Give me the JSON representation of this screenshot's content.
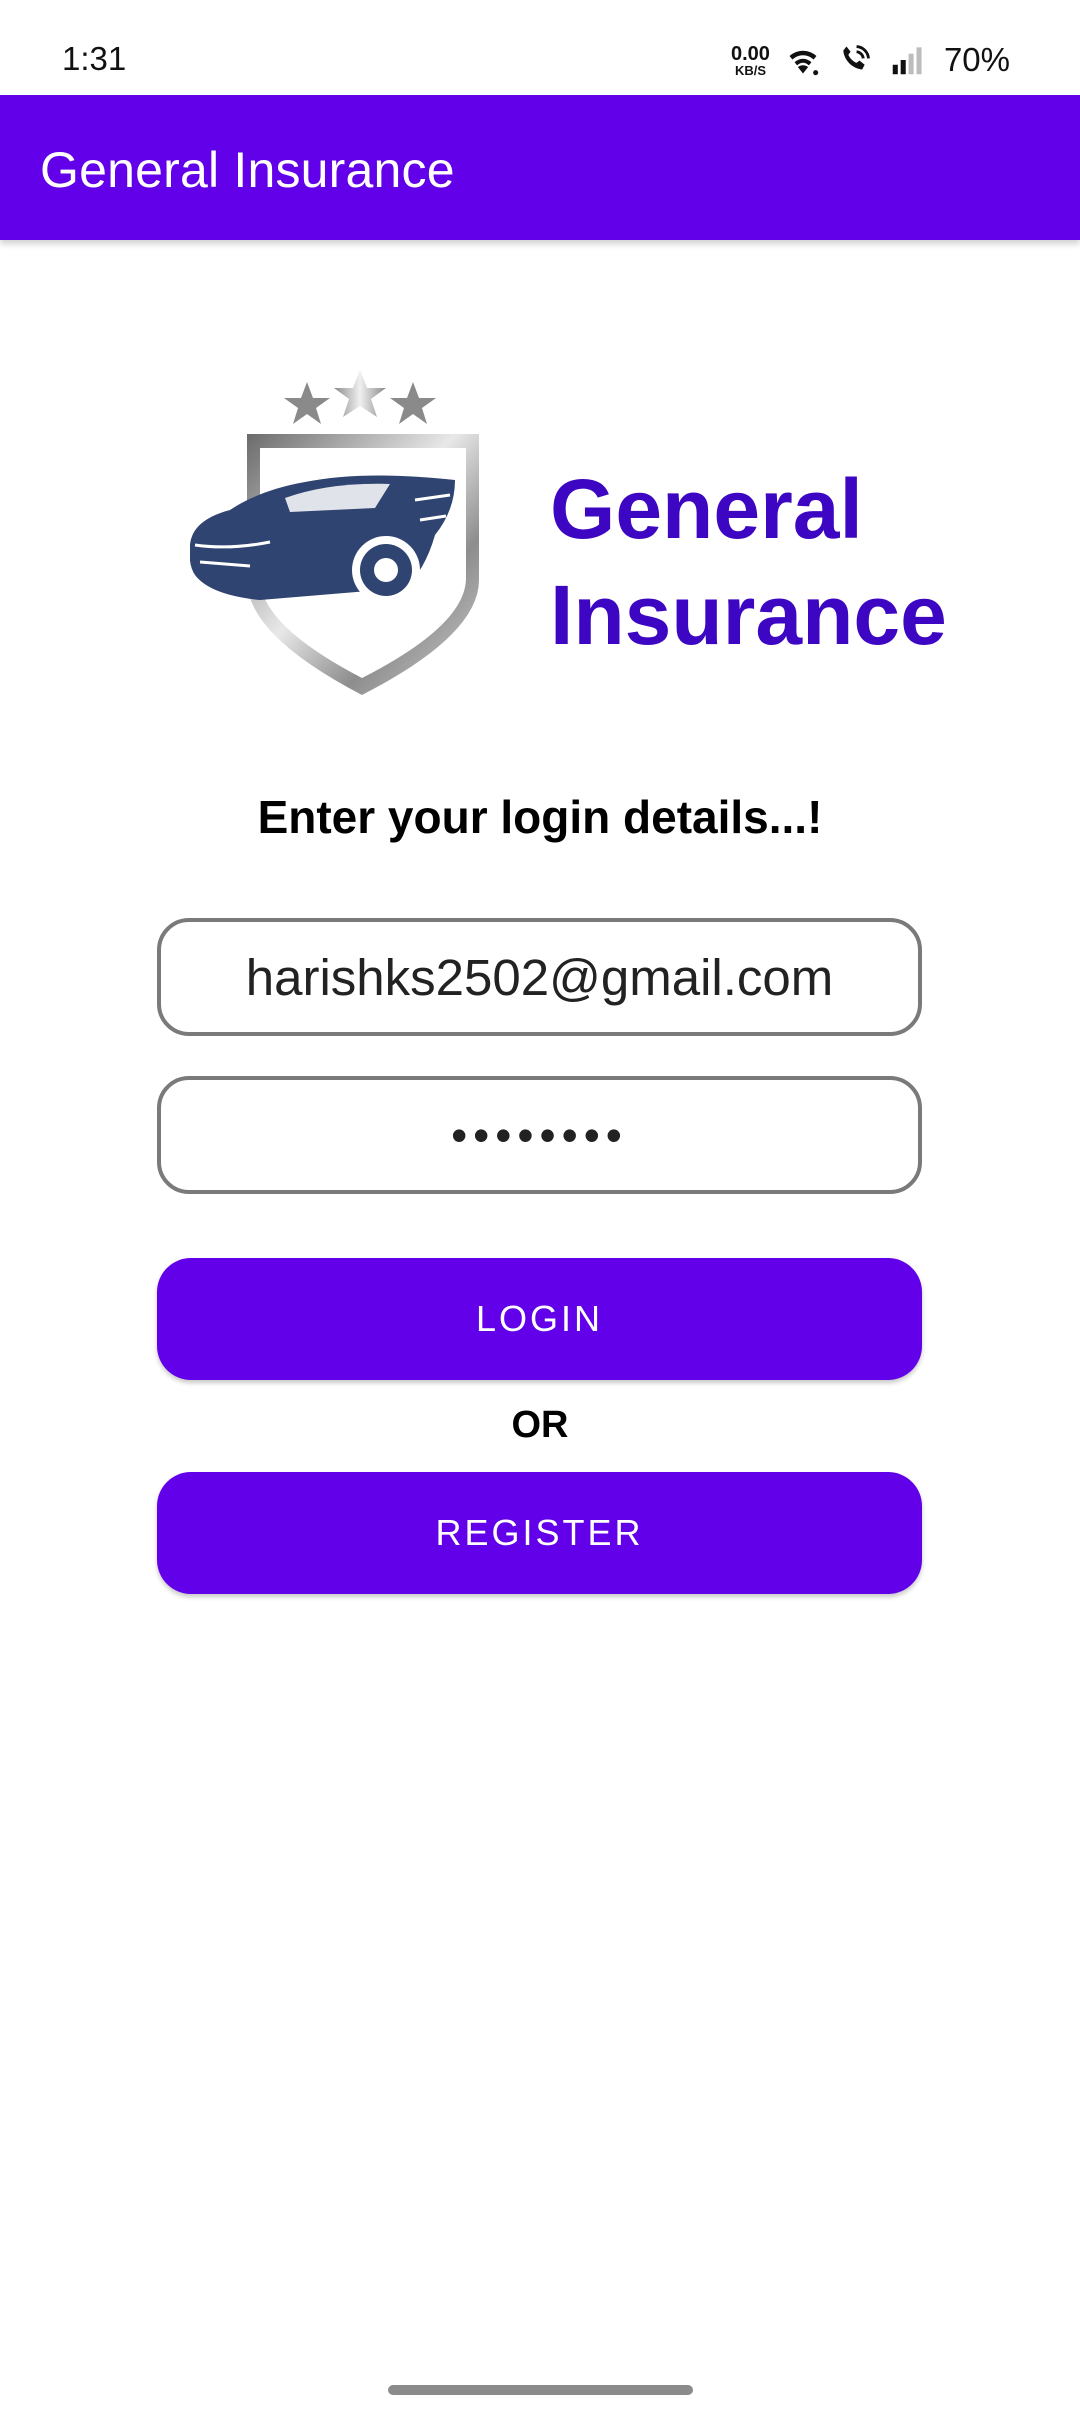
{
  "status_bar": {
    "time": "1:31",
    "net_speed_value": "0.00",
    "net_speed_unit": "KB/S",
    "battery": "70%",
    "icons": [
      "wifi-icon",
      "wifi-calling-icon",
      "signal-icon"
    ]
  },
  "app_bar": {
    "title": "General Insurance"
  },
  "logo": {
    "icon": "car-shield-logo",
    "brand_line1": "General",
    "brand_line2": "Insurance"
  },
  "form": {
    "heading": "Enter your login details...!",
    "email_value": "harishks2502@gmail.com",
    "password_value": "••••••••",
    "login_label": "LOGIN",
    "or_label": "OR",
    "register_label": "REGISTER"
  },
  "colors": {
    "primary": "#6200ea",
    "brand_text": "#3d06c2",
    "logo_car": "#2f4470"
  }
}
